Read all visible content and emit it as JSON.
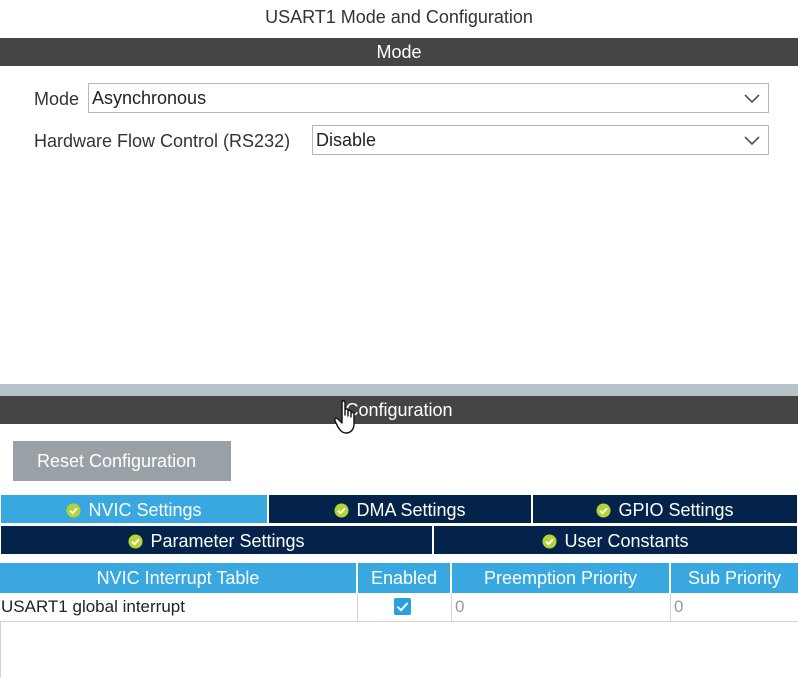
{
  "window": {
    "title": "USART1 Mode and Configuration"
  },
  "mode_section": {
    "title": "Mode",
    "fields": [
      {
        "label": "Mode",
        "value": "Asynchronous"
      },
      {
        "label": "Hardware Flow Control (RS232)",
        "value": "Disable"
      }
    ]
  },
  "config_section": {
    "title": "Configuration",
    "reset_label": "Reset Configuration",
    "tabs": [
      {
        "label": "NVIC Settings",
        "active": true
      },
      {
        "label": "DMA Settings",
        "active": false
      },
      {
        "label": "GPIO Settings",
        "active": false
      },
      {
        "label": "Parameter Settings",
        "active": false
      },
      {
        "label": "User Constants",
        "active": false
      }
    ]
  },
  "nvic_table": {
    "headers": [
      "NVIC Interrupt Table",
      "Enabled",
      "Preemption Priority",
      "Sub Priority"
    ],
    "rows": [
      {
        "name": "USART1 global interrupt",
        "enabled": true,
        "preemption": "0",
        "sub": "0"
      }
    ]
  },
  "colors": {
    "section_bar": "#454545",
    "tab_active": "#39a8e0",
    "tab_inactive": "#03234b",
    "table_header": "#39a8e0",
    "check_accent": "#b5d334"
  }
}
